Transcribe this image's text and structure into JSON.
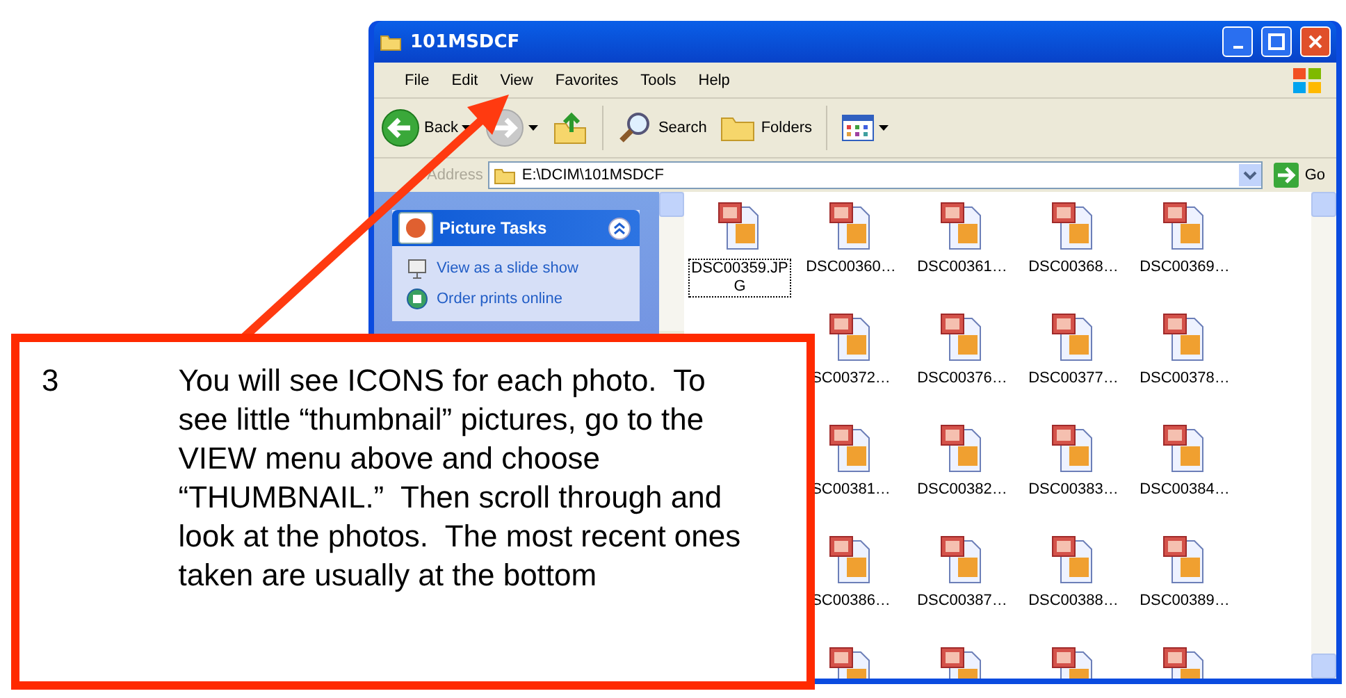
{
  "window": {
    "title": "101MSDCF"
  },
  "menu": [
    "File",
    "Edit",
    "View",
    "Favorites",
    "Tools",
    "Help"
  ],
  "toolbar": [
    {
      "kind": "back",
      "label": "Back"
    },
    {
      "kind": "forward"
    },
    {
      "kind": "up"
    },
    {
      "kind": "search",
      "label": "Search"
    },
    {
      "kind": "folders",
      "label": "Folders"
    },
    {
      "kind": "views"
    }
  ],
  "address": {
    "label": "Address",
    "value": "E:\\DCIM\\101MSDCF",
    "go": "Go"
  },
  "task_pane": {
    "title": "Picture Tasks",
    "expanded": true,
    "items": [
      "View as a slide show",
      "Order prints online"
    ]
  },
  "files": [
    {
      "first_hidden": false,
      "items": [
        {
          "kind": "file",
          "label": "DSC00359.JPG",
          "selected": true
        },
        {
          "kind": "file",
          "label": "DSC00360…",
          "selected": false
        },
        {
          "kind": "file",
          "label": "DSC00361…",
          "selected": false
        },
        {
          "kind": "file",
          "label": "DSC00368…",
          "selected": false
        },
        {
          "kind": "file",
          "label": "DSC00369…",
          "selected": false
        }
      ]
    },
    {
      "first_hidden": true,
      "items": [
        {
          "kind": "file",
          "label": "SC00372…",
          "selected": false
        },
        {
          "kind": "file",
          "label": "DSC00376…",
          "selected": false
        },
        {
          "kind": "file",
          "label": "DSC00377…",
          "selected": false
        },
        {
          "kind": "file",
          "label": "DSC00378…",
          "selected": false
        }
      ]
    },
    {
      "first_hidden": true,
      "items": [
        {
          "kind": "file",
          "label": "SC00381…",
          "selected": false
        },
        {
          "kind": "file",
          "label": "DSC00382…",
          "selected": false
        },
        {
          "kind": "file",
          "label": "DSC00383…",
          "selected": false
        },
        {
          "kind": "file",
          "label": "DSC00384…",
          "selected": false
        }
      ]
    },
    {
      "first_hidden": true,
      "items": [
        {
          "kind": "file",
          "label": "SC00386…",
          "selected": false
        },
        {
          "kind": "file",
          "label": "DSC00387…",
          "selected": false
        },
        {
          "kind": "file",
          "label": "DSC00388…",
          "selected": false
        },
        {
          "kind": "file",
          "label": "DSC00389…",
          "selected": false
        }
      ]
    },
    {
      "first_hidden": true,
      "items": [
        {
          "kind": "icon"
        },
        {
          "kind": "icon"
        },
        {
          "kind": "icon"
        },
        {
          "kind": "icon"
        }
      ]
    }
  ],
  "callout": {
    "step": "3",
    "text": "You will see ICONS for each photo.  To see little “thumbnail” pictures, go to the VIEW menu above and choose “THUMBNAIL.”  Then scroll through and look at the photos.  The most recent ones taken are usually at the bottom"
  }
}
